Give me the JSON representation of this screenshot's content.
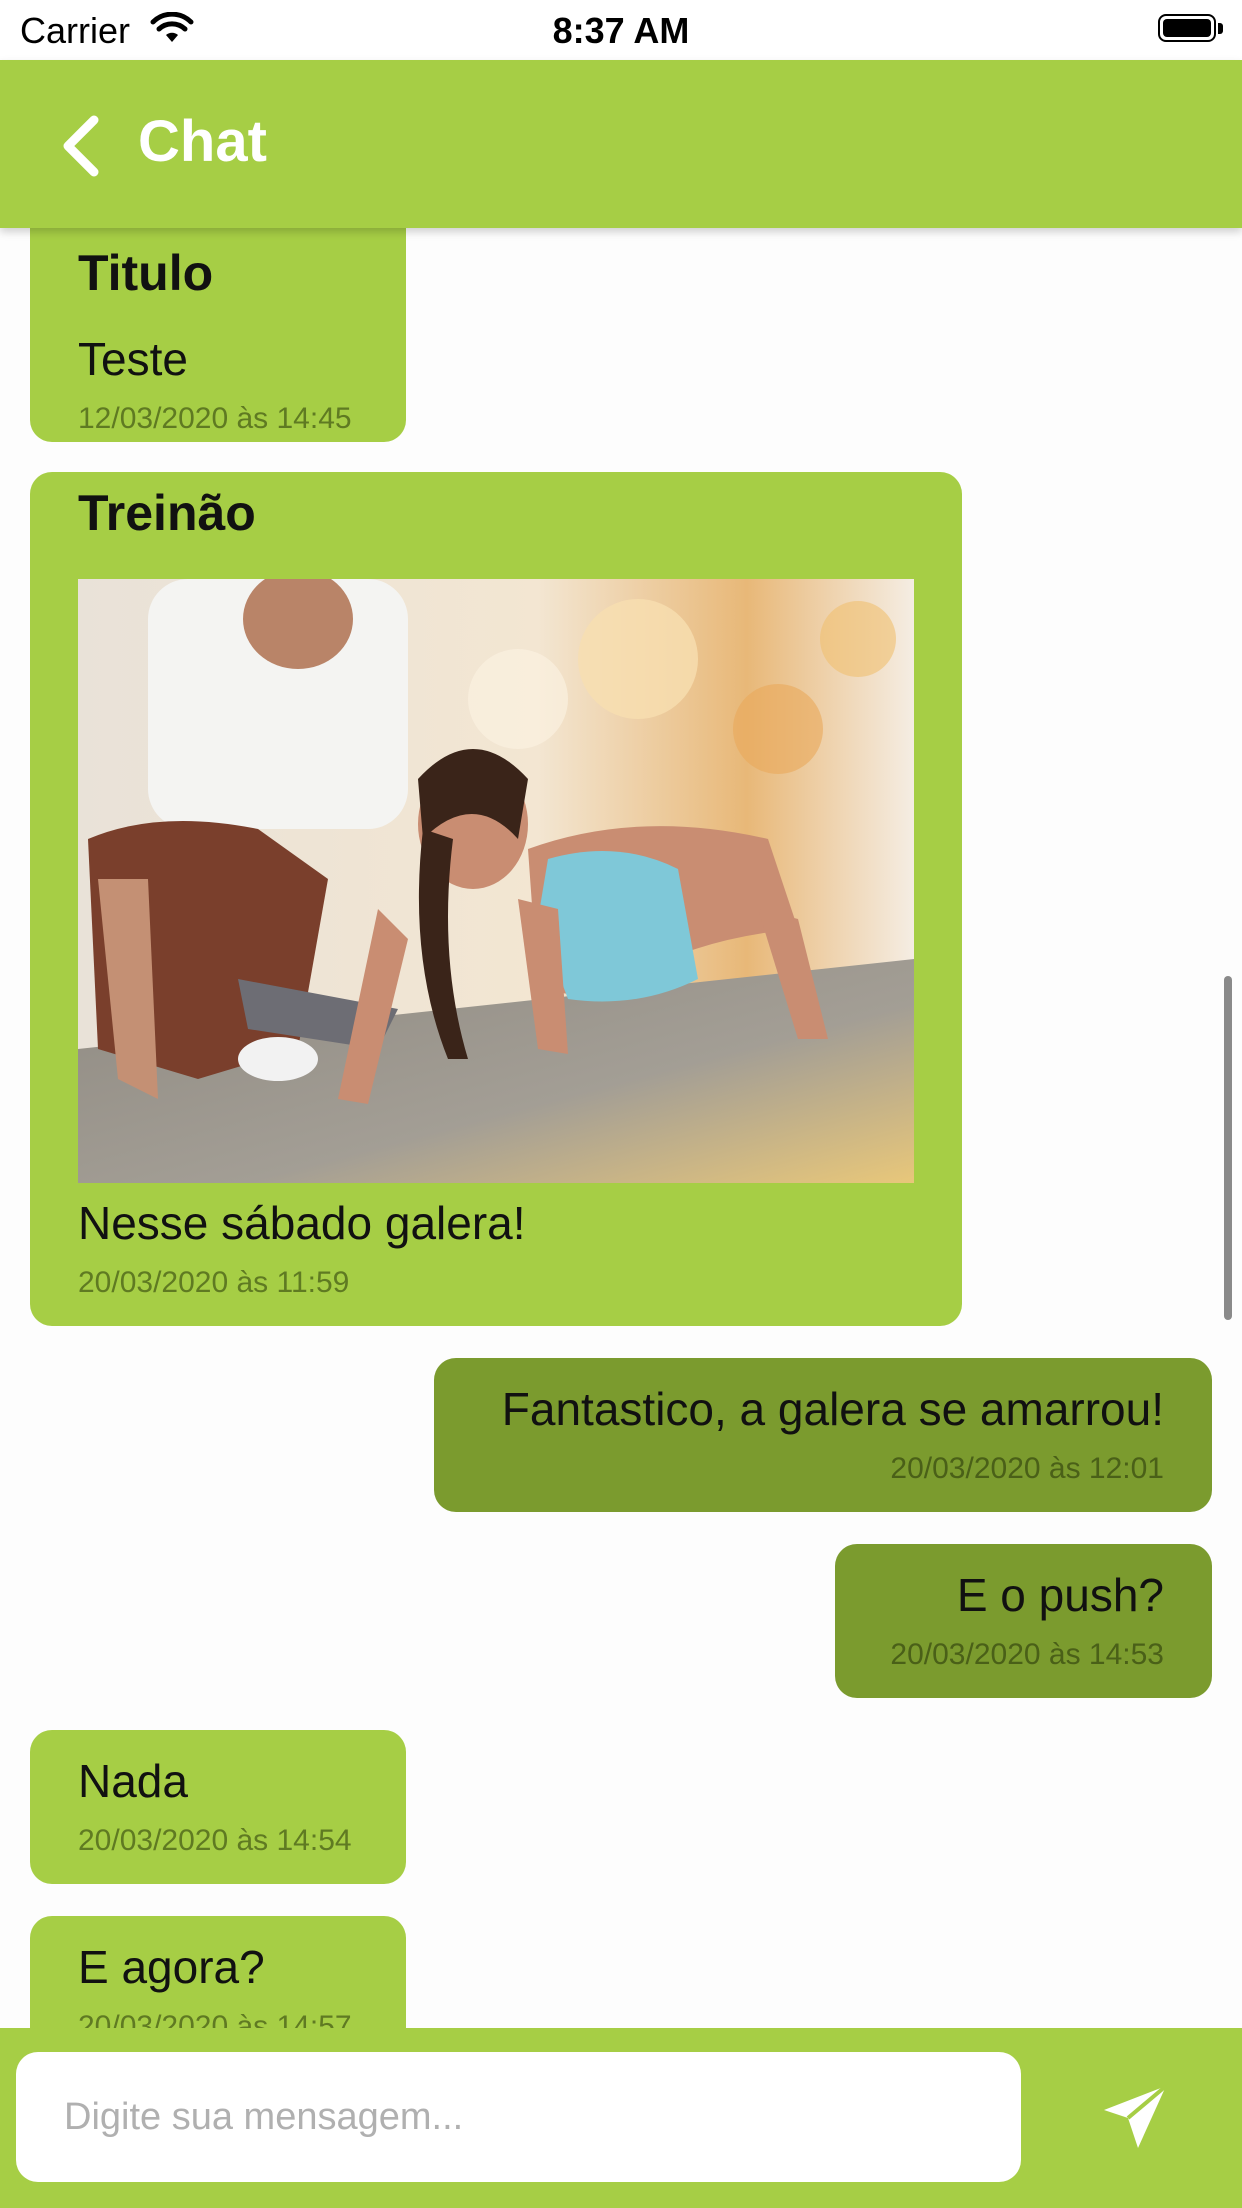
{
  "status_bar": {
    "carrier": "Carrier",
    "time": "8:37 AM"
  },
  "header": {
    "title": "Chat"
  },
  "messages": [
    {
      "direction": "in",
      "title": "Titulo",
      "text": "Teste",
      "time": "12/03/2020 às 14:45"
    },
    {
      "direction": "in",
      "title": "Treinão",
      "image": "push-up training photo",
      "text": "Nesse sábado galera!",
      "time": "20/03/2020 às 11:59"
    },
    {
      "direction": "out",
      "text": "Fantastico, a galera se amarrou!",
      "time": "20/03/2020 às 12:01"
    },
    {
      "direction": "out",
      "text": "E o push?",
      "time": "20/03/2020 às 14:53"
    },
    {
      "direction": "in",
      "text": "Nada",
      "time": "20/03/2020 às 14:54"
    },
    {
      "direction": "in",
      "text": "E agora?",
      "time": "20/03/2020 às 14:57"
    }
  ],
  "composer": {
    "placeholder": "Digite sua mensagem..."
  },
  "colors": {
    "primary": "#a6ce45",
    "outgoing": "#7b9b2e",
    "header_text": "#ffffff"
  },
  "icons": {
    "back": "chevron-left-icon",
    "send": "paper-plane-icon",
    "wifi": "wifi-icon",
    "battery": "battery-icon"
  }
}
